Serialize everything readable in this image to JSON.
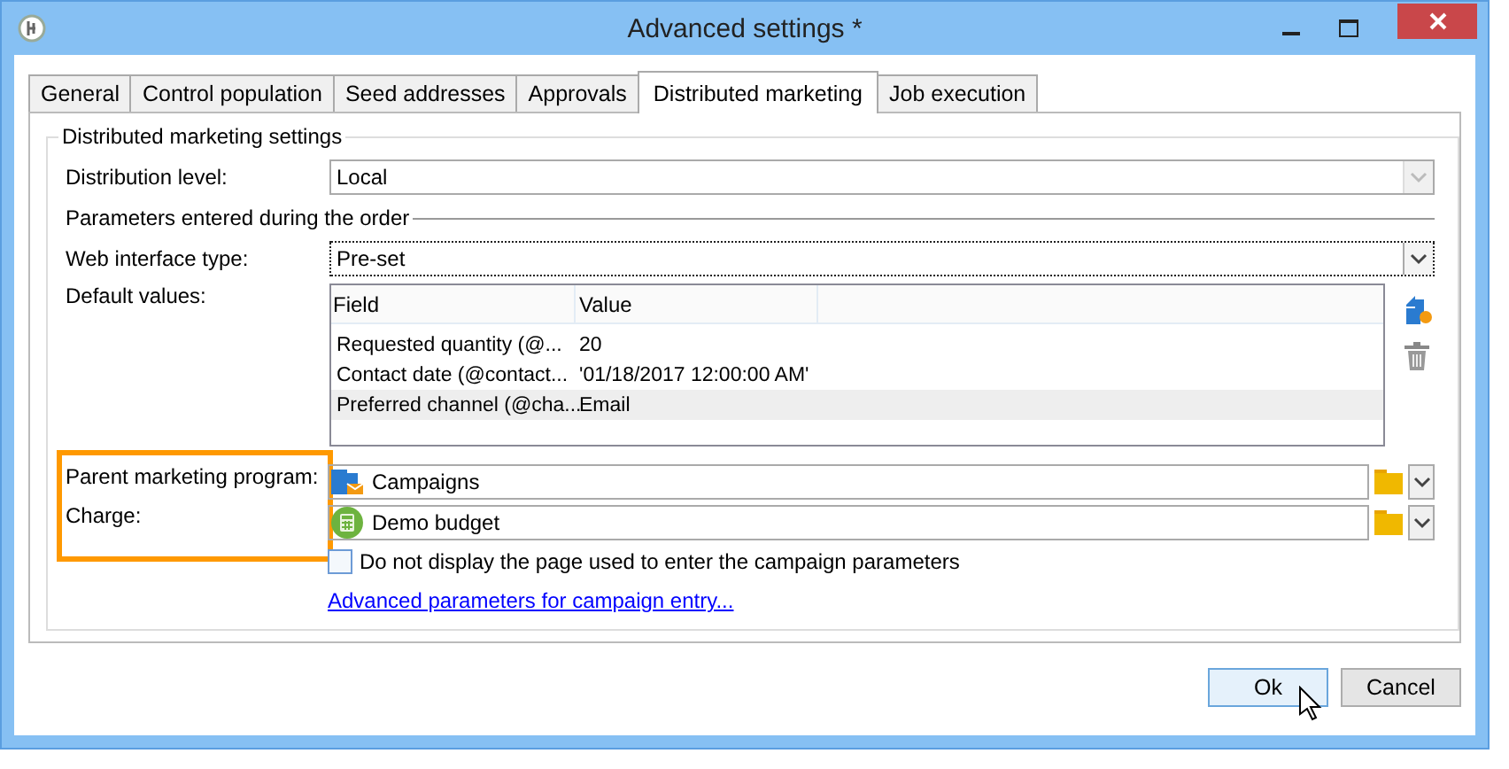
{
  "window": {
    "title": "Advanced settings *"
  },
  "tabs": [
    {
      "label": "General",
      "selected": false
    },
    {
      "label": "Control population",
      "selected": false
    },
    {
      "label": "Seed addresses",
      "selected": false
    },
    {
      "label": "Approvals",
      "selected": false
    },
    {
      "label": "Distributed marketing",
      "selected": true
    },
    {
      "label": "Job execution",
      "selected": false
    }
  ],
  "group_title": "Distributed marketing settings",
  "distribution_level": {
    "label": "Distribution level:",
    "value": "Local",
    "disabled": true
  },
  "section_title": "Parameters entered during the order",
  "web_interface_type": {
    "label": "Web interface type:",
    "value": "Pre-set",
    "focused": true
  },
  "default_values": {
    "label": "Default values:",
    "columns": [
      "Field",
      "Value"
    ],
    "rows": [
      {
        "cells": [
          "Requested quantity (@...",
          "20"
        ],
        "selected": false
      },
      {
        "cells": [
          "Contact date (@contact...",
          "'01/18/2017 12:00:00 AM'"
        ],
        "selected": false
      },
      {
        "cells": [
          "Preferred channel (@cha...",
          "Email"
        ],
        "selected": true
      }
    ]
  },
  "highlight": true,
  "parent_marketing_program": {
    "label": "Parent marketing program:",
    "value": "Campaigns"
  },
  "charge": {
    "label": "Charge:",
    "value": "Demo budget"
  },
  "checkbox": {
    "label": "Do not display the page used to enter the campaign parameters",
    "checked": false
  },
  "link": "Advanced parameters for campaign entry...",
  "buttons": [
    {
      "label": "Ok",
      "kind": "default"
    },
    {
      "label": "Cancel",
      "kind": "normal"
    }
  ]
}
